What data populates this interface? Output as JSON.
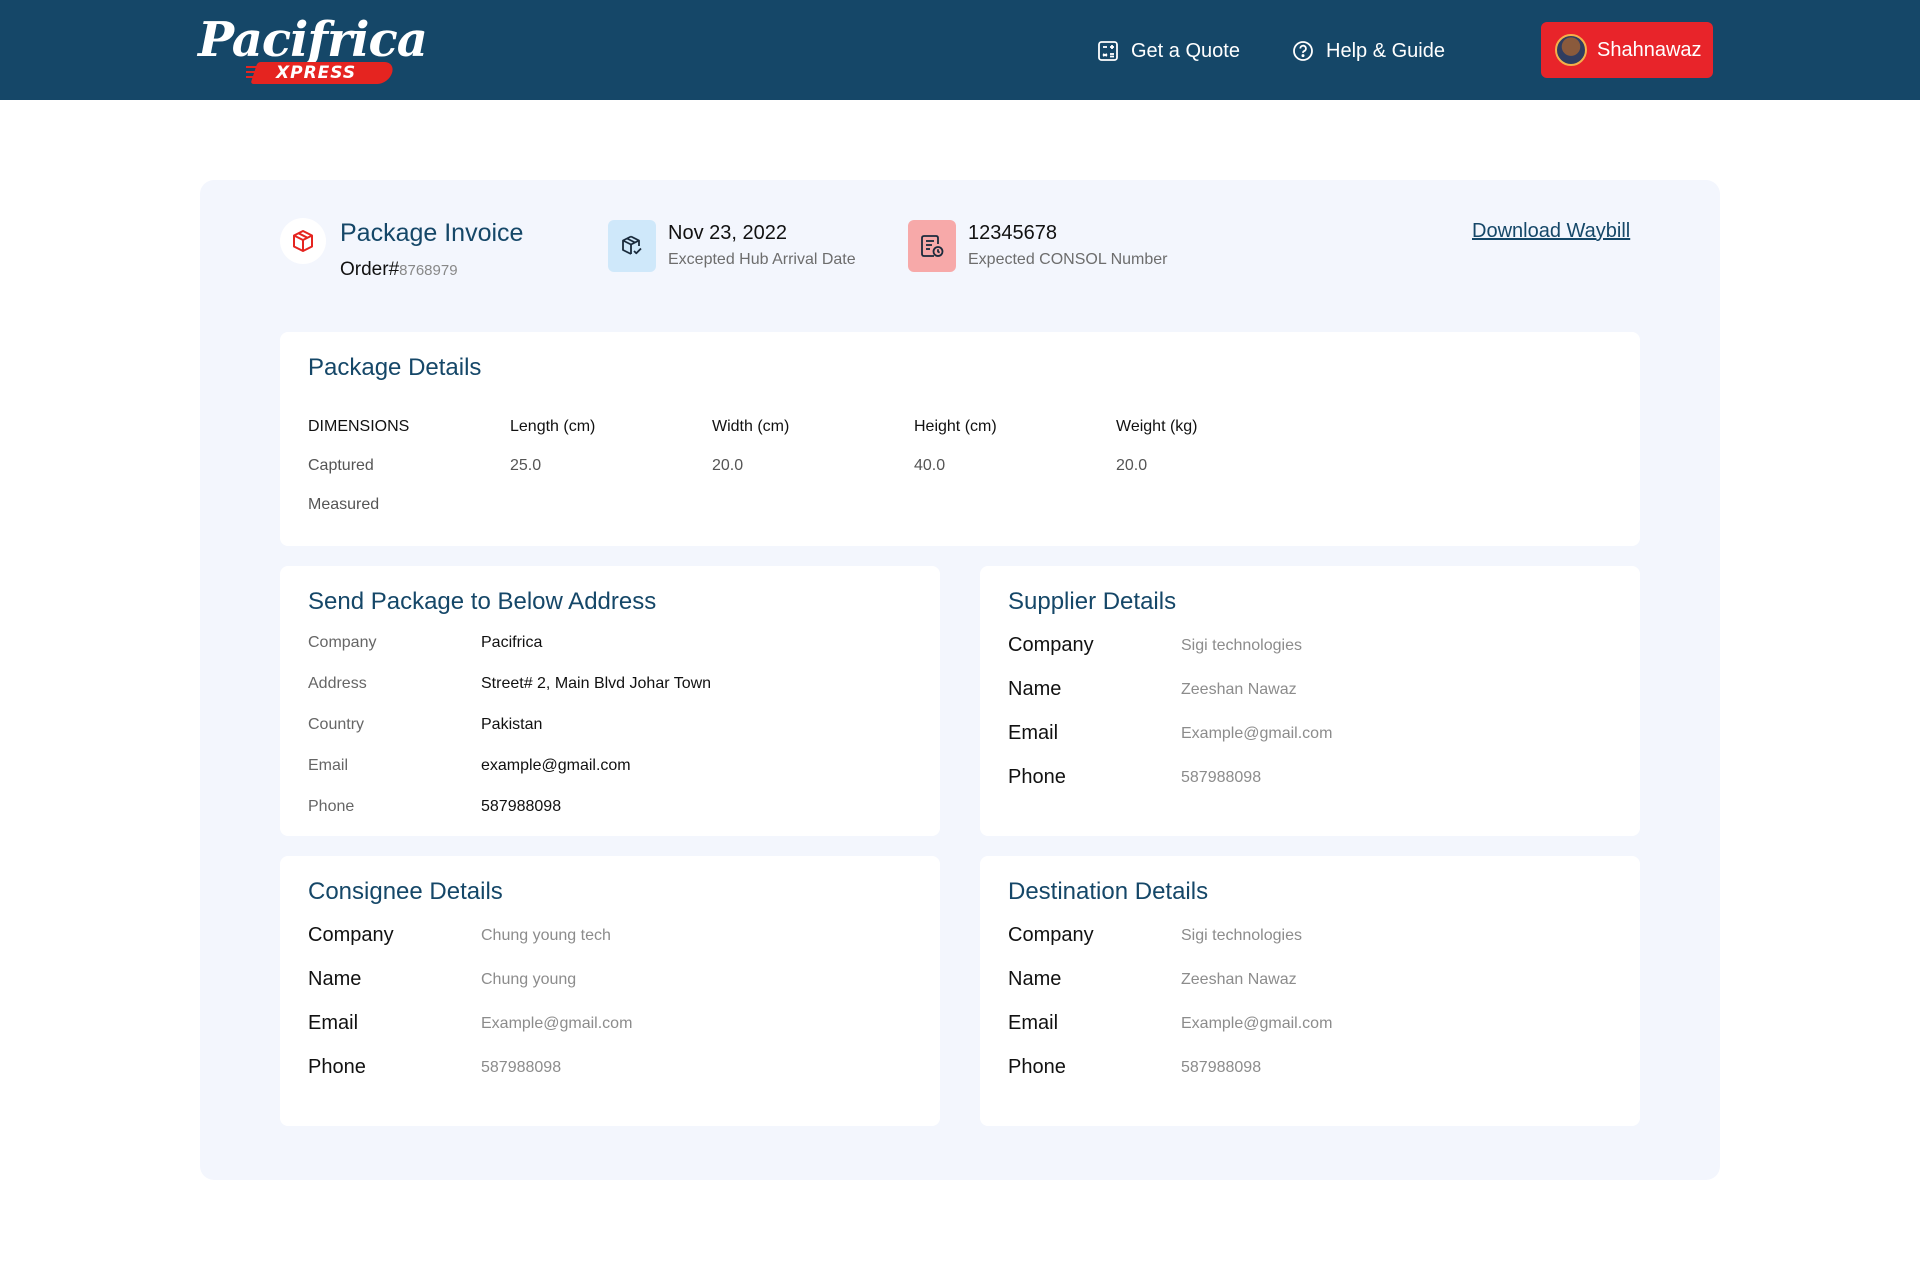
{
  "header": {
    "logo_main": "Pacifrica",
    "logo_sub": "XPRESS",
    "nav": [
      {
        "label": "Get a Quote",
        "icon": "calculator-icon"
      },
      {
        "label": "Help & Guide",
        "icon": "question-circle-icon"
      }
    ],
    "user": {
      "name": "Shahnawaz",
      "icon": "avatar"
    },
    "colors": {
      "bar": "#154768",
      "accent": "#e8242a"
    }
  },
  "invoice": {
    "title": "Package Invoice",
    "order_label": "Order#",
    "order_number": "8768979",
    "arrival": {
      "value": "Nov 23, 2022",
      "label": "Excepted Hub Arrival Date",
      "icon": "package-check-icon"
    },
    "consol": {
      "value": "12345678",
      "label": "Expected CONSOL Number",
      "icon": "document-clock-icon"
    },
    "download_label": "Download Waybill"
  },
  "package_details": {
    "title": "Package Details",
    "headers": [
      "DIMENSIONS",
      "Length (cm)",
      "Width (cm)",
      "Height (cm)",
      "Weight (kg)"
    ],
    "captured": [
      "Captured",
      "25.0",
      "20.0",
      "40.0",
      "20.0"
    ],
    "measured": [
      "Measured",
      "",
      "",
      "",
      ""
    ]
  },
  "send_address": {
    "title": "Send Package to Below Address",
    "rows": [
      {
        "label": "Company",
        "value": "Pacifrica"
      },
      {
        "label": "Address",
        "value": "Street# 2, Main Blvd Johar Town"
      },
      {
        "label": "Country",
        "value": "Pakistan"
      },
      {
        "label": "Email",
        "value": "example@gmail.com"
      },
      {
        "label": "Phone",
        "value": "587988098"
      }
    ]
  },
  "supplier": {
    "title": "Supplier Details",
    "rows": [
      {
        "label": "Company",
        "value": "Sigi technologies"
      },
      {
        "label": "Name",
        "value": "Zeeshan Nawaz"
      },
      {
        "label": "Email",
        "value": "Example@gmail.com"
      },
      {
        "label": "Phone",
        "value": "587988098"
      }
    ]
  },
  "consignee": {
    "title": "Consignee Details",
    "rows": [
      {
        "label": "Company",
        "value": "Chung young tech"
      },
      {
        "label": "Name",
        "value": "Chung young"
      },
      {
        "label": "Email",
        "value": "Example@gmail.com"
      },
      {
        "label": "Phone",
        "value": "587988098"
      }
    ]
  },
  "destination": {
    "title": "Destination Details",
    "rows": [
      {
        "label": "Company",
        "value": "Sigi technologies"
      },
      {
        "label": "Name",
        "value": "Zeeshan Nawaz"
      },
      {
        "label": "Email",
        "value": "Example@gmail.com"
      },
      {
        "label": "Phone",
        "value": "587988098"
      }
    ]
  }
}
